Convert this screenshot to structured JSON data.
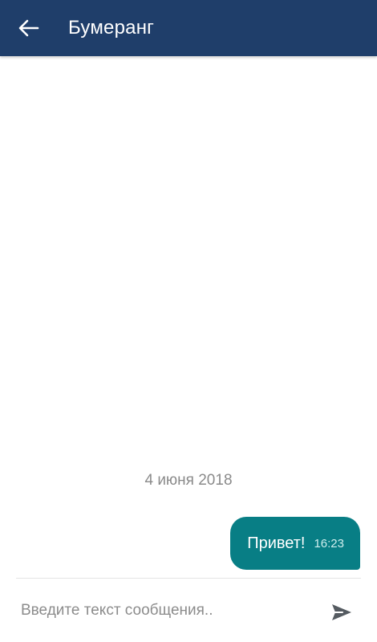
{
  "header": {
    "title": "Бумеранг",
    "back_icon": "arrow-left-icon",
    "background_color": "#1f3e6a"
  },
  "chat": {
    "date_separator": "4 июня 2018",
    "messages": [
      {
        "direction": "outgoing",
        "text": "Привет!",
        "time": "16:23",
        "bubble_color": "#087e85"
      }
    ]
  },
  "composer": {
    "placeholder": "Введите текст сообщения..",
    "value": "",
    "send_icon": "send-icon"
  }
}
